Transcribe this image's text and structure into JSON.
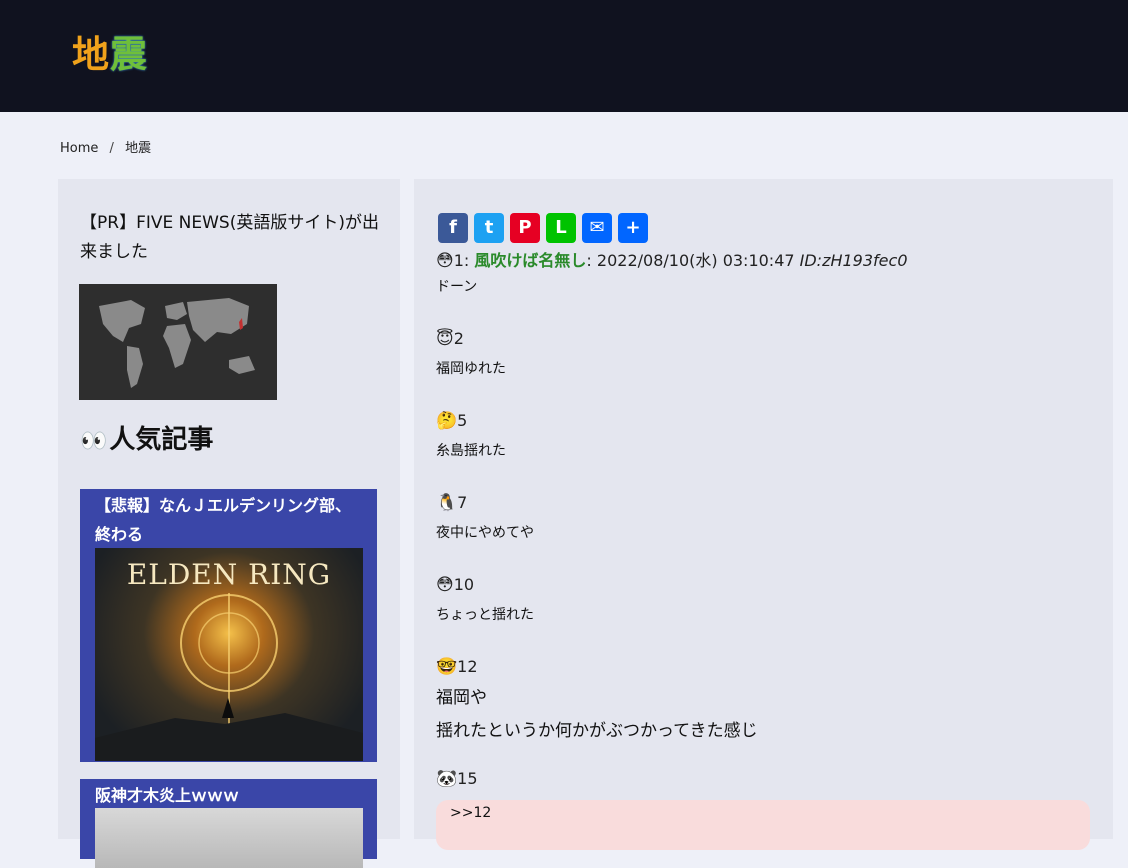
{
  "site": {
    "logo_char1": "地",
    "logo_char2": "震"
  },
  "breadcrumb": {
    "home": "Home",
    "separator": "/",
    "current": "地震"
  },
  "sidebar": {
    "pr_text": "【PR】FIVE NEWS(英語版サイト)が出来ました",
    "popular_icon": "👀",
    "popular_title": "人気記事",
    "articles": [
      {
        "title": "【悲報】なんＪエルデンリング部、終わる",
        "image_text": "ELDEN RING"
      },
      {
        "title": "阪神才木炎上ｗｗｗ"
      }
    ]
  },
  "share": {
    "buttons": [
      {
        "name": "facebook",
        "label": "f",
        "color": "#3b5998"
      },
      {
        "name": "twitter",
        "label": "t",
        "color": "#1da1f2"
      },
      {
        "name": "pinterest",
        "label": "P",
        "color": "#e60023"
      },
      {
        "name": "line",
        "label": "L",
        "color": "#00c300"
      },
      {
        "name": "email",
        "label": "✉",
        "color": "#0166ff"
      },
      {
        "name": "share",
        "label": "+",
        "color": "#0166ff"
      }
    ]
  },
  "posts": [
    {
      "emoji": "😳",
      "num": "1",
      "colon": ": ",
      "name": "風吹けば名無し",
      "date": ": 2022/08/10(水) 03:10:47 ",
      "id": "ID:zH193fec0",
      "body": "ドーン"
    },
    {
      "emoji": "😇",
      "num": "2",
      "body": "福岡ゆれた"
    },
    {
      "emoji": "🤔",
      "num": "5",
      "body": "糸島揺れた"
    },
    {
      "emoji": "🐧",
      "num": "7",
      "body": "夜中にやめてや"
    },
    {
      "emoji": "😳",
      "num": "10",
      "body": "ちょっと揺れた"
    },
    {
      "emoji": "🤓",
      "num": "12",
      "body_line1": "福岡や",
      "body_line2": "揺れたというか何かがぶつかってきた感じ"
    },
    {
      "emoji": "🐼",
      "num": "15",
      "quote": ">>12"
    }
  ]
}
